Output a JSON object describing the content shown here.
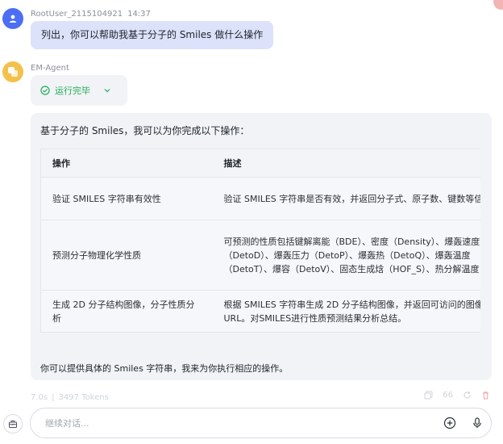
{
  "user_message": {
    "username": "RootUser_2115104921",
    "time": "14:37",
    "text": "列出，你可以帮助我基于分子的 Smiles 做什么操作"
  },
  "agent": {
    "name": "EM-Agent",
    "status": "运行完毕",
    "intro": "基于分子的 Smiles，我可以为你完成以下操作：",
    "table": {
      "headers": [
        "操作",
        "描述"
      ],
      "rows": [
        [
          "验证 SMILES 字符串有效性",
          "验证 SMILES 字符串是否有效，并返回分子式、原子数、键数等信息"
        ],
        [
          "预测分子物理化学性质",
          "可预测的性质包括键解离能（BDE）、密度（Density）、爆轰速度（DetoD）、爆轰压力（DetoP）、爆轰热（DetoQ）、爆轰温度（DetoT）、爆容（DetoV）、固态生成焓（HOF_S）、热分解温度（Td）"
        ],
        [
          "生成 2D 分子结构图像，分子性质分析",
          "根据 SMILES 字符串生成 2D 分子结构图像，并返回可访问的图像 URL。对SMILES进行性质预测结果分析总结。"
        ]
      ]
    },
    "outro": "你可以提供具体的 Smiles 字符串，我来为你执行相应的操作。",
    "stats": {
      "duration": "7.0s",
      "tokens": "3497 Tokens"
    },
    "count": "66"
  },
  "composer": {
    "placeholder": "继续对话..."
  },
  "colors": {
    "accent": "#4b6ef5",
    "success": "#1eac52",
    "user_bubble": "#dde2fb",
    "panel": "#f1f3f7"
  }
}
